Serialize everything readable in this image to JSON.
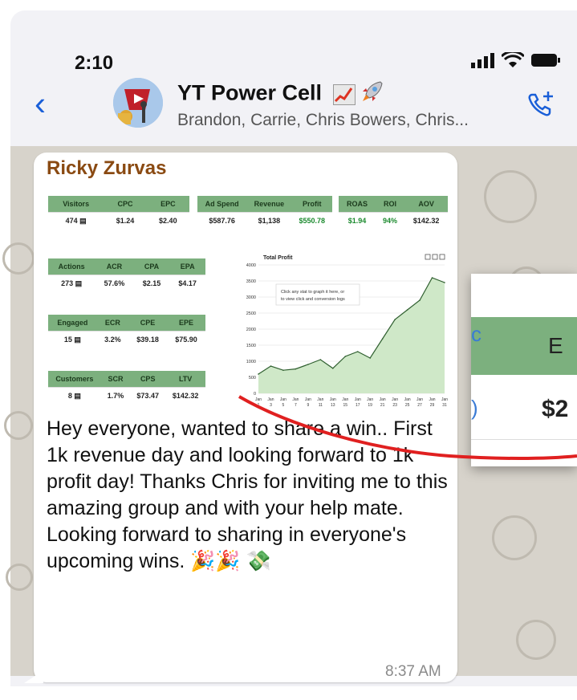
{
  "status": {
    "time": "2:10"
  },
  "header": {
    "title": "YT Power Cell",
    "members": "Brandon, Carrie, Chris Bowers, Chris..."
  },
  "message": {
    "sender": "Ricky Zurvas",
    "text": "Hey everyone, wanted to share a win.. First 1k revenue day and looking forward to 1k profit day! Thanks Chris for inviting me to this amazing group and with your help mate. Looking forward to sharing in everyone's upcoming wins. 🎉🎉 💸",
    "time": "8:37 AM"
  },
  "dashboard": {
    "row1": {
      "a": {
        "headers": [
          "Visitors",
          "CPC",
          "EPC"
        ],
        "values": [
          "474 ▤",
          "$1.24",
          "$2.40"
        ]
      },
      "b": {
        "headers": [
          "Ad Spend",
          "Revenue",
          "Profit"
        ],
        "values": [
          "$587.76",
          "$1,138",
          "$550.78"
        ]
      },
      "c": {
        "headers": [
          "ROAS",
          "ROI",
          "AOV"
        ],
        "values": [
          "$1.94",
          "94%",
          "$142.32"
        ]
      }
    },
    "actions": {
      "headers": [
        "Actions",
        "ACR",
        "CPA",
        "EPA"
      ],
      "values": [
        "273 ▤",
        "57.6%",
        "$2.15",
        "$4.17"
      ]
    },
    "engaged": {
      "headers": [
        "Engaged",
        "ECR",
        "CPE",
        "EPE"
      ],
      "values": [
        "15 ▤",
        "3.2%",
        "$39.18",
        "$75.90"
      ]
    },
    "customers": {
      "headers": [
        "Customers",
        "SCR",
        "CPS",
        "LTV"
      ],
      "values": [
        "8 ▤",
        "1.7%",
        "$73.47",
        "$142.32"
      ]
    }
  },
  "chart_data": {
    "type": "area",
    "title": "Total Profit",
    "note_line1": "Click any stat to graph it here, or",
    "note_line2": "to view click and conversion logs",
    "ylim": [
      0,
      4000
    ],
    "yticks": [
      0,
      500,
      1000,
      1500,
      2000,
      2500,
      3000,
      3500,
      4000
    ],
    "x": [
      "Jan 1",
      "Jan 3",
      "Jan 5",
      "Jan 7",
      "Jan 9",
      "Jan 11",
      "Jan 13",
      "Jan 15",
      "Jan 17",
      "Jan 19",
      "Jan 21",
      "Jan 23",
      "Jan 25",
      "Jan 27",
      "Jan 29",
      "Jan 31"
    ],
    "values": [
      600,
      850,
      720,
      760,
      900,
      1050,
      780,
      1150,
      1300,
      1100,
      1700,
      2300,
      2600,
      2900,
      3600,
      3450
    ],
    "xlabels": [
      [
        "Jan",
        "1"
      ],
      [
        "Jan",
        "3"
      ],
      [
        "Jan",
        "5"
      ],
      [
        "Jan",
        "7"
      ],
      [
        "Jan",
        "9"
      ],
      [
        "Jan",
        "11"
      ],
      [
        "Jan",
        "13"
      ],
      [
        "Jan",
        "15"
      ],
      [
        "Jan",
        "17"
      ],
      [
        "Jan",
        "19"
      ],
      [
        "Jan",
        "21"
      ],
      [
        "Jan",
        "23"
      ],
      [
        "Jan",
        "25"
      ],
      [
        "Jan",
        "27"
      ],
      [
        "Jan",
        "29"
      ],
      [
        "Jan",
        "31"
      ]
    ],
    "colors": {
      "fill": "#cfe8c8",
      "line": "#2f5f2f"
    }
  },
  "popup": {
    "header_letter": "E",
    "value": "$2",
    "left_top": "c",
    "left_bottom": ")"
  }
}
